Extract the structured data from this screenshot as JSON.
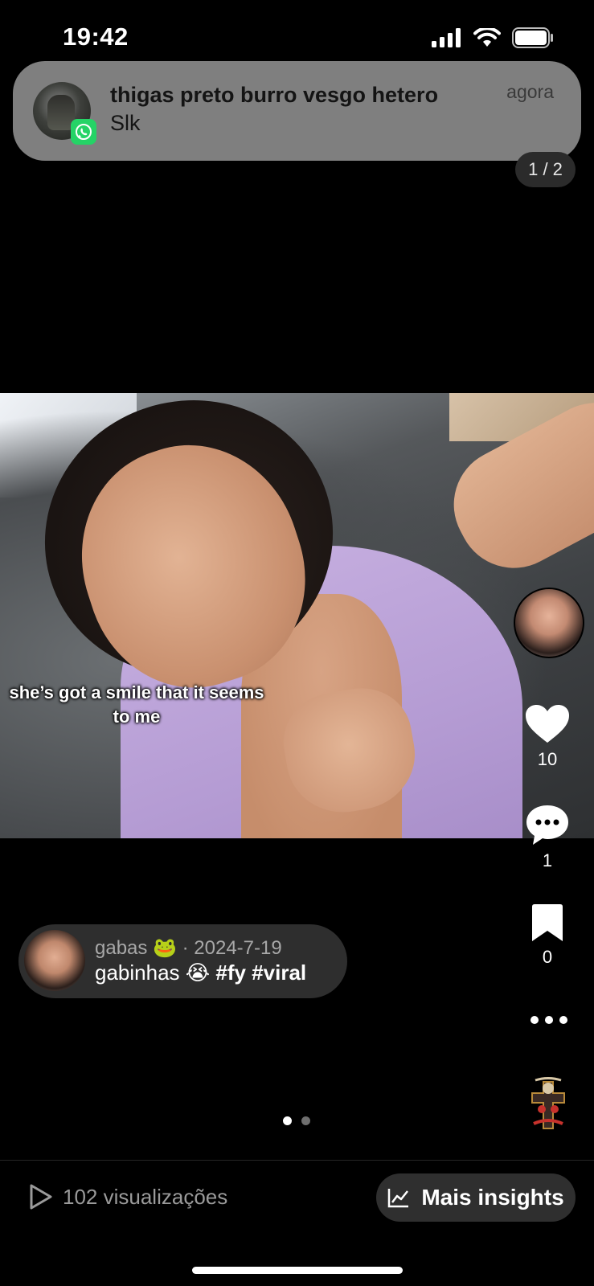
{
  "status_bar": {
    "time": "19:42",
    "icons": [
      "signal-icon",
      "wifi-icon",
      "battery-icon"
    ]
  },
  "notification": {
    "app_icon": "whatsapp-icon",
    "title": "thigas preto burro vesgo hetero",
    "message": "Slk",
    "time": "agora"
  },
  "media": {
    "counter": "1 / 2",
    "caption_overlay": "she’s got a smile that it seems to me"
  },
  "actions": {
    "likes": "10",
    "comments": "1",
    "saves": "0"
  },
  "post": {
    "author_line": "gabas 🐸 · 2024-7-19",
    "caption_text": "gabinhas 😭",
    "hashtags": "#fy #viral"
  },
  "pagination": {
    "total": 2,
    "active": 1,
    "active_color": "#ffffff",
    "inactive_color": "#6f6f6f"
  },
  "footer": {
    "views": "102 visualizações",
    "insights_label": "Mais insights"
  }
}
